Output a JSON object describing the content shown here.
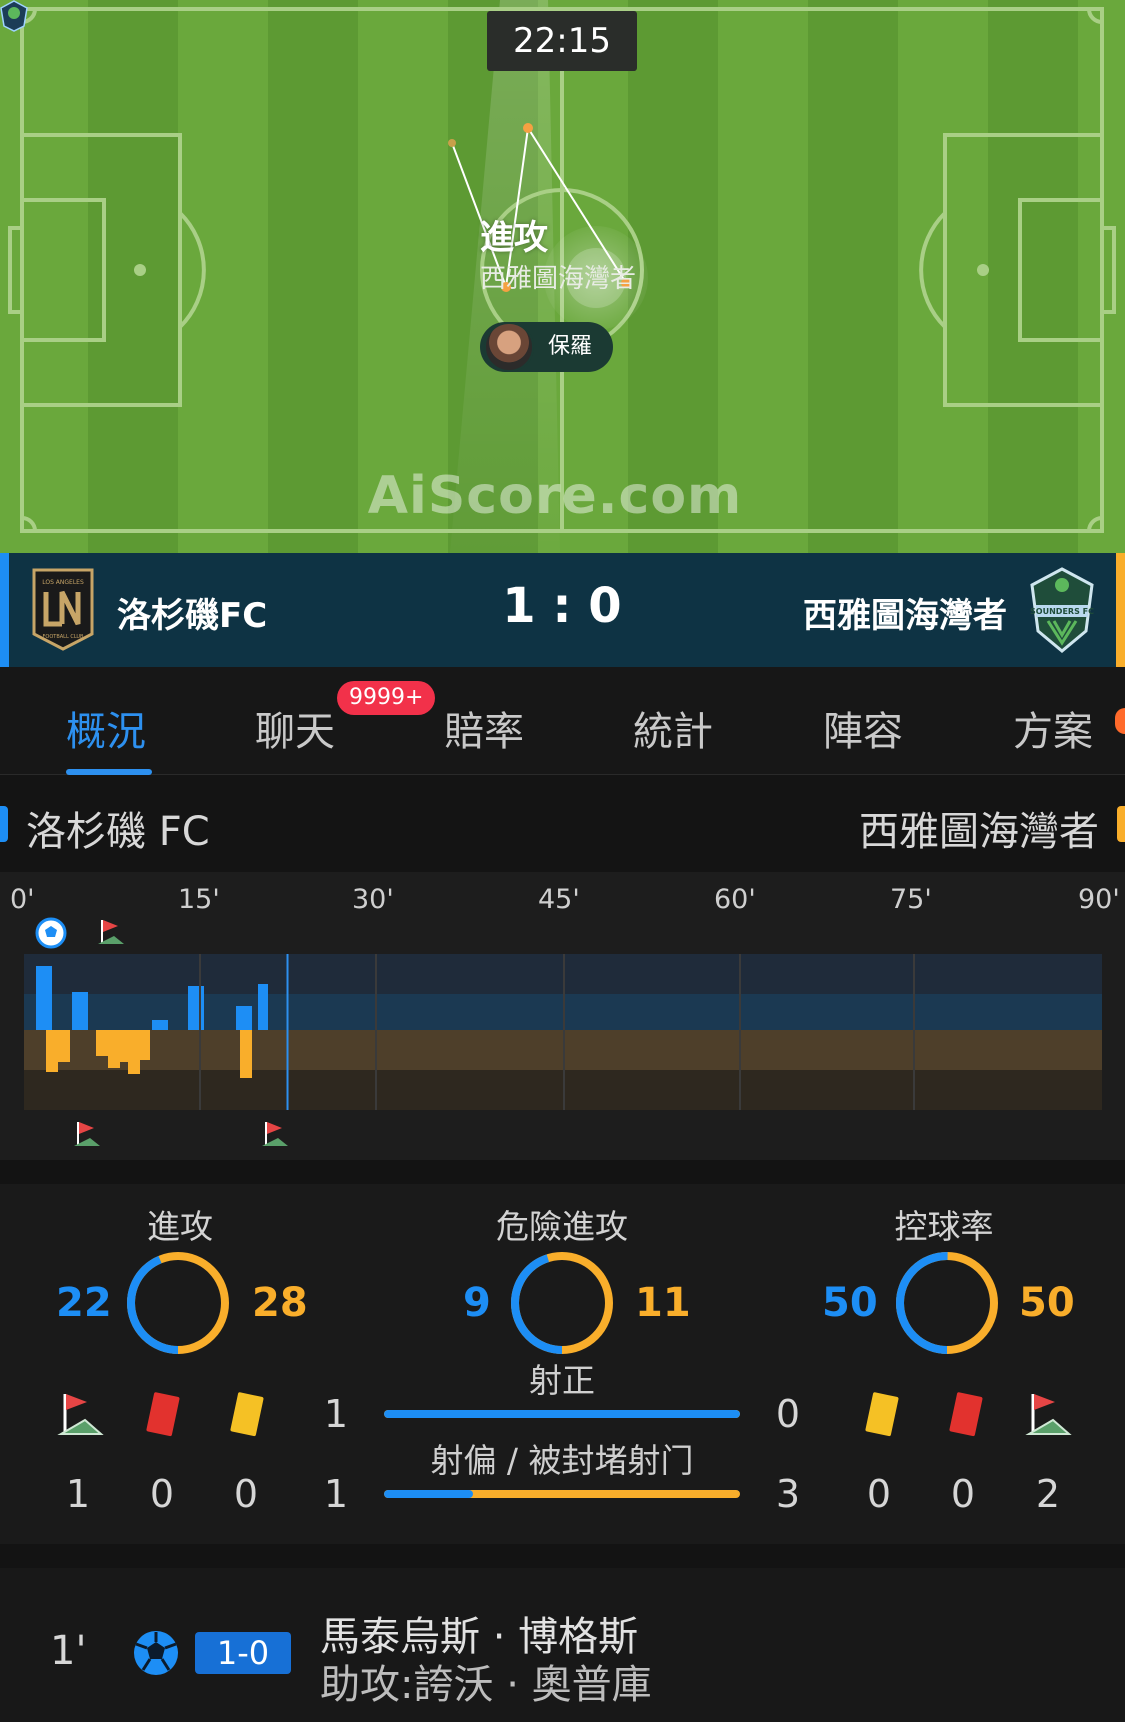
{
  "pitch": {
    "clock": "22:15",
    "play_label": "進攻",
    "play_team": "西雅圖海灣者",
    "player_name": "保羅",
    "watermark": "AiScore.com"
  },
  "match": {
    "home_name": "洛杉磯FC",
    "away_name": "西雅圖海灣者",
    "score": "1 : 0"
  },
  "tabs": [
    {
      "label": "概況",
      "active": true
    },
    {
      "label": "聊天"
    },
    {
      "label": "賠率"
    },
    {
      "label": "統計"
    },
    {
      "label": "陣容"
    },
    {
      "label": "方案"
    }
  ],
  "chat_badge": "9999+",
  "timeline": {
    "home_name": "洛杉磯 FC",
    "away_name": "西雅圖海灣者",
    "ticks": [
      "0'",
      "15'",
      "30'",
      "45'",
      "60'",
      "75'",
      "90'"
    ],
    "current_minute": 22
  },
  "stats": {
    "attack": {
      "title": "進攻",
      "home": "22",
      "away": "28"
    },
    "dangerous": {
      "title": "危險進攻",
      "home": "9",
      "away": "11"
    },
    "possession": {
      "title": "控球率",
      "home": "50",
      "away": "50"
    },
    "on_target": {
      "title": "射正",
      "home": "1",
      "away": "0"
    },
    "off_target": {
      "title": "射偏 / 被封堵射门",
      "home": "1",
      "away": "3"
    },
    "home_corners": "1",
    "home_red": "0",
    "home_yellow": "0",
    "away_yellow": "0",
    "away_red": "0",
    "away_corners": "2"
  },
  "event": {
    "minute": "1'",
    "score": "1-0",
    "player": "馬泰烏斯 · 博格斯",
    "assist": "助攻:誇沃 · 奧普庫"
  },
  "colors": {
    "home": "#1d8ef5",
    "away": "#f9ae2b",
    "pitch": "#67a43a"
  }
}
